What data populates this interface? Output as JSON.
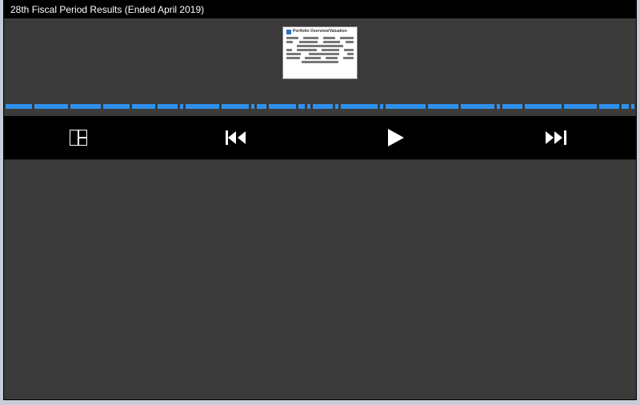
{
  "title": "28th Fiscal Period Results (Ended April 2019)",
  "thumbnail": {
    "heading": "Portfolio Overview/Valuation"
  },
  "timeline": {
    "segments": [
      40,
      50,
      45,
      40,
      35,
      30,
      5,
      50,
      40,
      5,
      15,
      40,
      10,
      5,
      30,
      5,
      55,
      5,
      60,
      45,
      50,
      5,
      30,
      55,
      50,
      30,
      10,
      5
    ]
  },
  "controls": {
    "layout": "layout-toggle",
    "prev": "previous",
    "play": "play",
    "next": "next"
  },
  "colors": {
    "accent": "#2f8feb",
    "bg": "#3a3a3a"
  }
}
